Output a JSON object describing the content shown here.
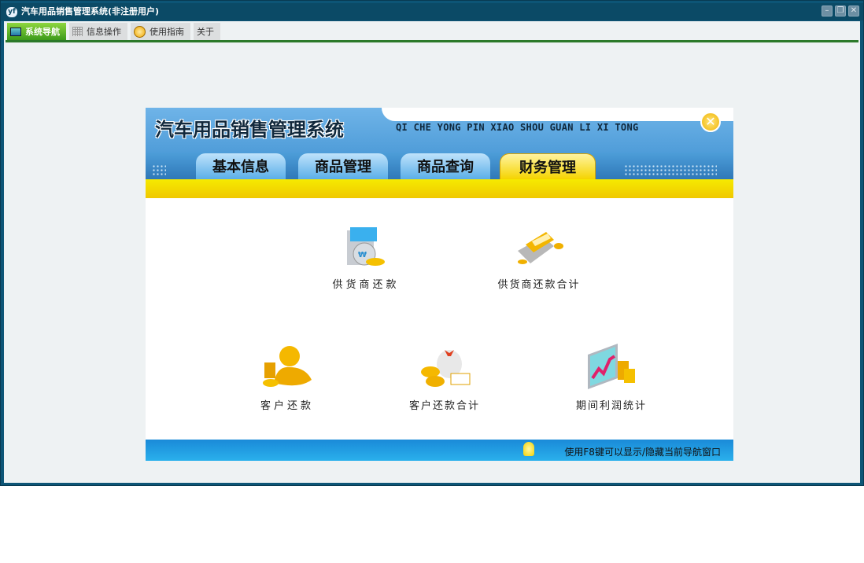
{
  "window": {
    "title": "汽车用品销售管理系统(非注册用户)",
    "app_icon": "yf-logo-icon",
    "minimize": "–",
    "restore": "❐",
    "close": "✕"
  },
  "tabs": [
    {
      "label": "系统导航",
      "icon": "monitor-icon"
    },
    {
      "label": "信息操作",
      "icon": "grid-icon"
    },
    {
      "label": "使用指南",
      "icon": "help-icon"
    },
    {
      "label": "关于"
    }
  ],
  "panel": {
    "title": "汽车用品销售管理系统",
    "pinyin": "QI CHE YONG PIN XIAO SHOU GUAN LI XI TONG",
    "close": "✕",
    "nav_tabs": [
      "基本信息",
      "商品管理",
      "商品查询",
      "财务管理"
    ],
    "active_tab": "财务管理",
    "items": [
      {
        "label": "供货商还款",
        "icon": "supplier-payment-icon"
      },
      {
        "label": "供货商还款合计",
        "icon": "supplier-payment-total-icon"
      },
      {
        "label": "客户还款",
        "icon": "customer-payment-icon"
      },
      {
        "label": "客户还款合计",
        "icon": "customer-payment-total-icon"
      },
      {
        "label": "期间利润统计",
        "icon": "profit-stats-icon"
      }
    ],
    "footer_hint": "使用F8键可以显示/隐藏当前导航窗口"
  }
}
